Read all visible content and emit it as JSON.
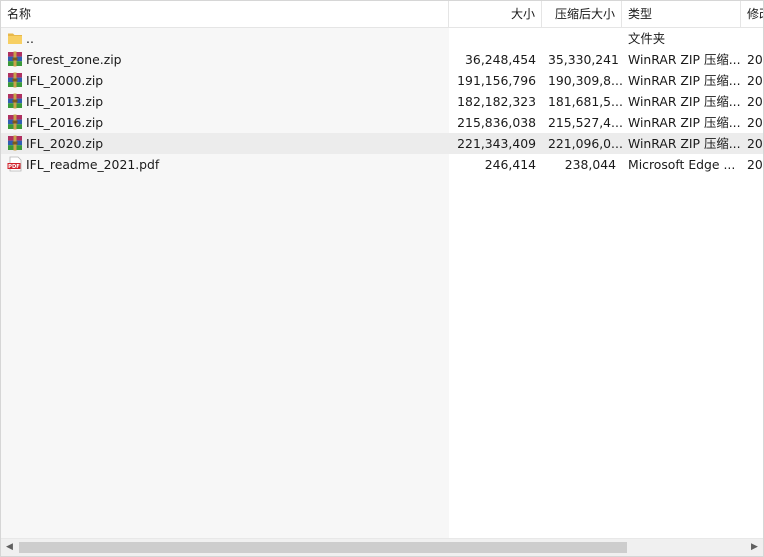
{
  "columns": {
    "name": "名称",
    "size": "大小",
    "packed": "压缩后大小",
    "type": "类型",
    "modified": "修改"
  },
  "sort_indicator": "^",
  "rows": [
    {
      "name": "..",
      "size": "",
      "packed": "",
      "type": "文件夹",
      "modified": "",
      "icon": "folder-icon"
    },
    {
      "name": "Forest_zone.zip",
      "size": "36,248,454",
      "packed": "35,330,241",
      "type": "WinRAR ZIP 压缩...",
      "modified": "20",
      "icon": "winrar-zip-icon"
    },
    {
      "name": "IFL_2000.zip",
      "size": "191,156,796",
      "packed": "190,309,8...",
      "type": "WinRAR ZIP 压缩...",
      "modified": "20",
      "icon": "winrar-zip-icon"
    },
    {
      "name": "IFL_2013.zip",
      "size": "182,182,323",
      "packed": "181,681,5...",
      "type": "WinRAR ZIP 压缩...",
      "modified": "20",
      "icon": "winrar-zip-icon"
    },
    {
      "name": "IFL_2016.zip",
      "size": "215,836,038",
      "packed": "215,527,4...",
      "type": "WinRAR ZIP 压缩...",
      "modified": "20",
      "icon": "winrar-zip-icon"
    },
    {
      "name": "IFL_2020.zip",
      "size": "221,343,409",
      "packed": "221,096,0...",
      "type": "WinRAR ZIP 压缩...",
      "modified": "20",
      "icon": "winrar-zip-icon"
    },
    {
      "name": "IFL_readme_2021.pdf",
      "size": "246,414",
      "packed": "238,044",
      "type": "Microsoft Edge ...",
      "modified": "20",
      "icon": "pdf-icon"
    }
  ],
  "pdf_icon_text": "PDF",
  "scrollbar": {
    "left_arrow": "◀",
    "right_arrow": "▶"
  }
}
